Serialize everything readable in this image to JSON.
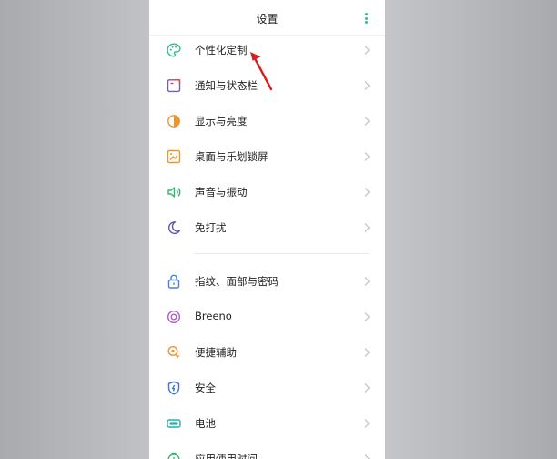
{
  "header": {
    "title": "设置",
    "more_icon": "more-vertical-icon"
  },
  "colors": {
    "accent": "#2fbf8e",
    "annotation_arrow": "#d62020",
    "chevron": "#c7c7c7"
  },
  "items": [
    {
      "label": "个性化定制",
      "icon": "palette-icon"
    },
    {
      "label": "通知与状态栏",
      "icon": "notification-icon"
    },
    {
      "label": "显示与亮度",
      "icon": "brightness-icon"
    },
    {
      "label": "桌面与乐划锁屏",
      "icon": "wallpaper-icon"
    },
    {
      "label": "声音与振动",
      "icon": "speaker-icon"
    },
    {
      "label": "免打扰",
      "icon": "moon-icon"
    },
    {
      "label": "指纹、面部与密码",
      "icon": "lock-icon"
    },
    {
      "label": "Breeno",
      "icon": "breeno-icon"
    },
    {
      "label": "便捷辅助",
      "icon": "assist-icon"
    },
    {
      "label": "安全",
      "icon": "shield-icon"
    },
    {
      "label": "电池",
      "icon": "battery-icon"
    },
    {
      "label": "应用使用时间",
      "icon": "app-usage-icon"
    }
  ]
}
